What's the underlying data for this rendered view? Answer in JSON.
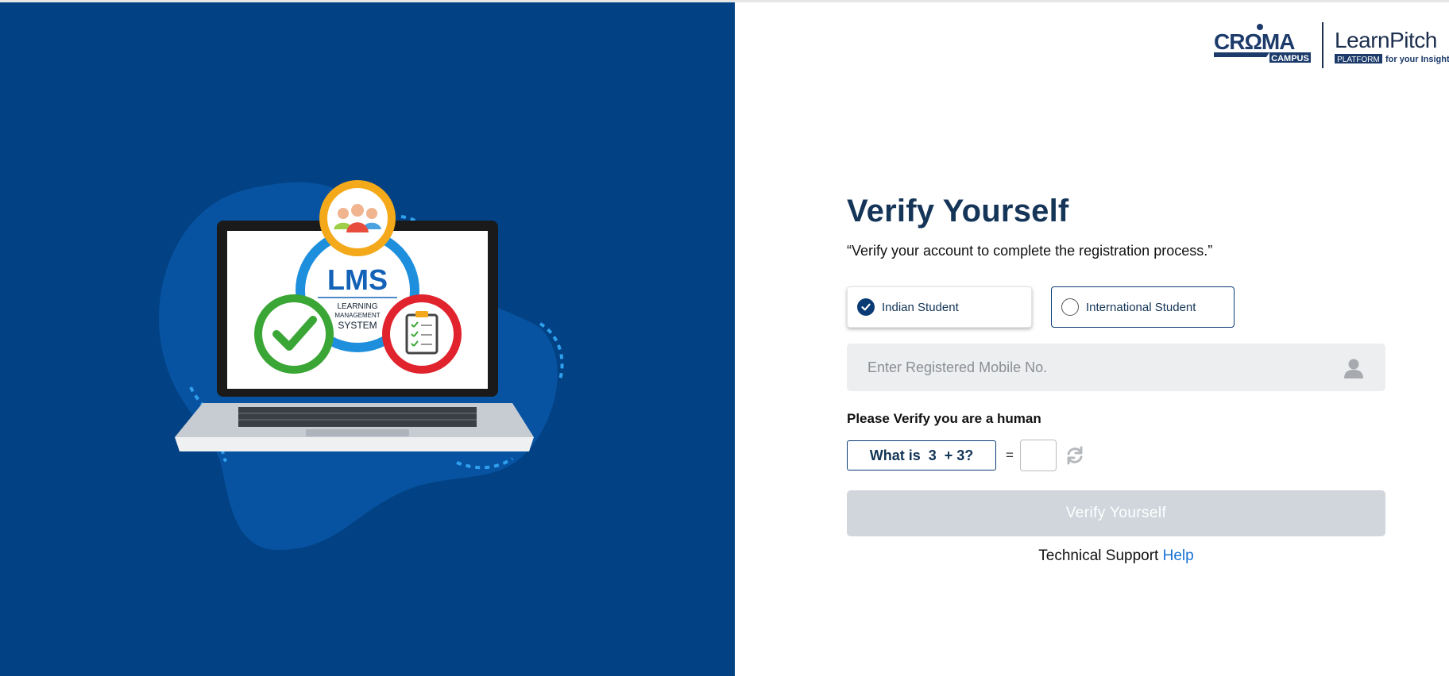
{
  "brand": {
    "croma_logo_text": "CROMA",
    "croma_logo_sub": "CAMPUS",
    "learnpitch_logo_text": "LearnPitch",
    "learnpitch_badge": "PLATFORM",
    "learnpitch_tagline": "for your Insight"
  },
  "illustration": {
    "lms_title": "LMS",
    "lms_line1": "LEARNING",
    "lms_line2": "MANAGEMENT",
    "lms_line3": "SYSTEM"
  },
  "form": {
    "title": "Verify Yourself",
    "subtitle": "“Verify your account to complete the registration process.”",
    "student_types": [
      {
        "label": "Indian Student",
        "selected": true
      },
      {
        "label": "International Student",
        "selected": false
      }
    ],
    "mobile_placeholder": "Enter Registered Mobile No.",
    "mobile_value": "",
    "captcha_label": "Please Verify you are a human",
    "captcha_question": "What is  3  + 3?",
    "equals": "=",
    "captcha_answer": "",
    "submit_label": "Verify Yourself",
    "support_text": "Technical Support",
    "help_link": "Help"
  },
  "icons": {
    "user": "user-icon",
    "refresh": "refresh-icon",
    "check": "check-icon"
  },
  "colors": {
    "left_panel_bg": "#024183",
    "title": "#143458",
    "accent_border": "#0b3b74",
    "button_disabled": "#d0d6dc",
    "link": "#1471d6"
  }
}
